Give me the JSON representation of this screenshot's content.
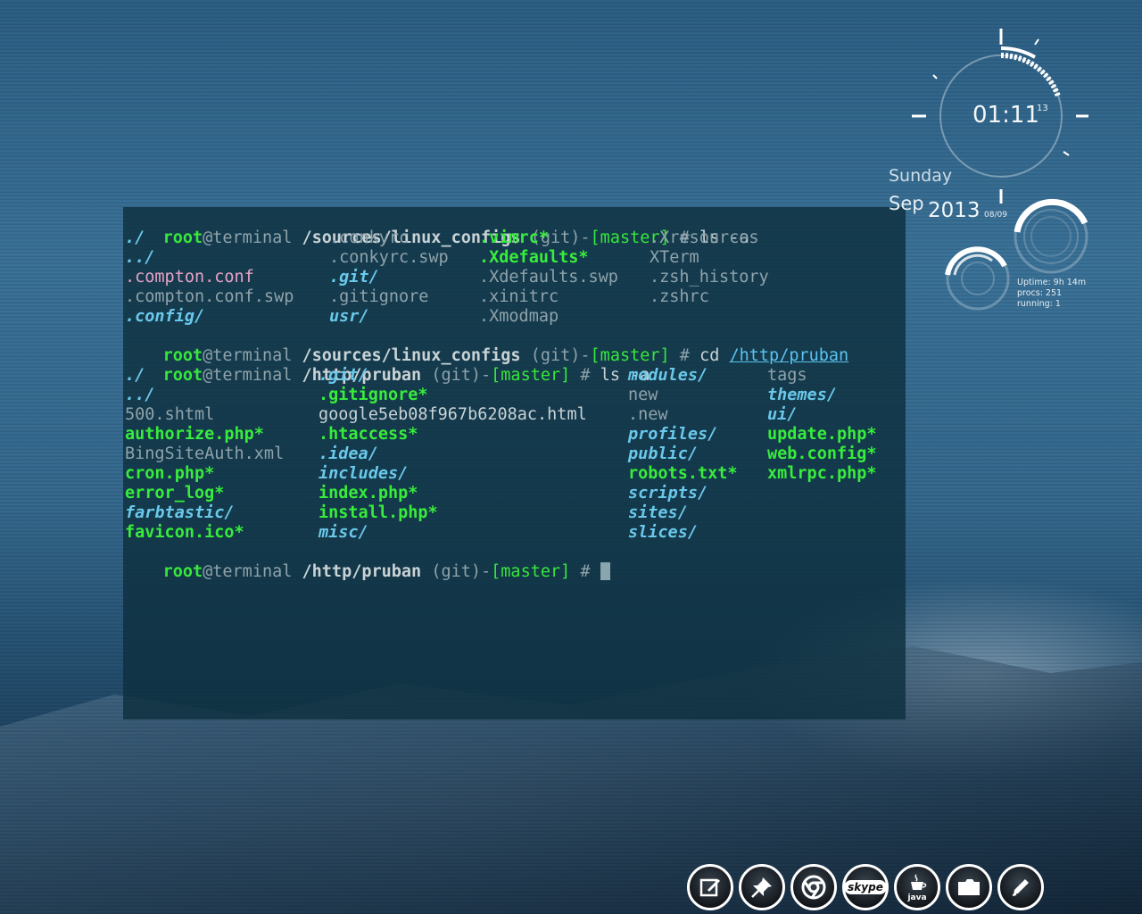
{
  "terminal": {
    "prompt_user": "root",
    "prompt_host": "@terminal",
    "prompt_git": "(git)",
    "prompt_dash": "-",
    "prompt_branch": "[master]",
    "prompt_hash": "#",
    "cwd1": "/sources/linux_configs",
    "cmd1": "ls -a",
    "cmd2_prefix": "cd ",
    "cmd2_link_a": "/http",
    "cmd2_link_b": "/pruban",
    "cwd2": "/http/pruban",
    "cmd3": "ls -a",
    "listing1": [
      [
        "./",
        ".conkyrc",
        ".vimrc*",
        ".Xresources"
      ],
      [
        "../",
        ".conkyrc.swp",
        ".Xdefaults*",
        "XTerm"
      ],
      [
        ".compton.conf",
        ".git/",
        ".Xdefaults.swp",
        ".zsh_history"
      ],
      [
        ".compton.conf.swp",
        ".gitignore",
        ".xinitrc",
        ".zshrc"
      ],
      [
        ".config/",
        "usr/",
        ".Xmodmap",
        ""
      ]
    ],
    "listing2": [
      [
        "./",
        ".git/",
        "modules/",
        "tags"
      ],
      [
        "../",
        ".gitignore*",
        "new",
        "themes/"
      ],
      [
        "500.shtml",
        "google5eb08f967b6208ac.html",
        ".new",
        "ui/"
      ],
      [
        "authorize.php*",
        ".htaccess*",
        "profiles/",
        "update.php*"
      ],
      [
        "BingSiteAuth.xml",
        ".idea/",
        "public/",
        "web.config*"
      ],
      [
        "cron.php*",
        "includes/",
        "robots.txt*",
        "xmlrpc.php*"
      ],
      [
        "error_log*",
        "index.php*",
        "scripts/",
        ""
      ],
      [
        "farbtastic/",
        "install.php*",
        "sites/",
        ""
      ],
      [
        "favicon.ico*",
        "misc/",
        "slices/",
        ""
      ]
    ]
  },
  "clock": {
    "time": "01:11",
    "seconds": "13",
    "day": "Sunday",
    "month": "Sep",
    "year": "2013",
    "date_small": "08/09"
  },
  "stats": {
    "uptime": "Uptime: 9h 14m",
    "procs": "procs: 251",
    "running": "running: 1"
  },
  "dock": {
    "java_label": "java",
    "skype_label": "skype"
  }
}
